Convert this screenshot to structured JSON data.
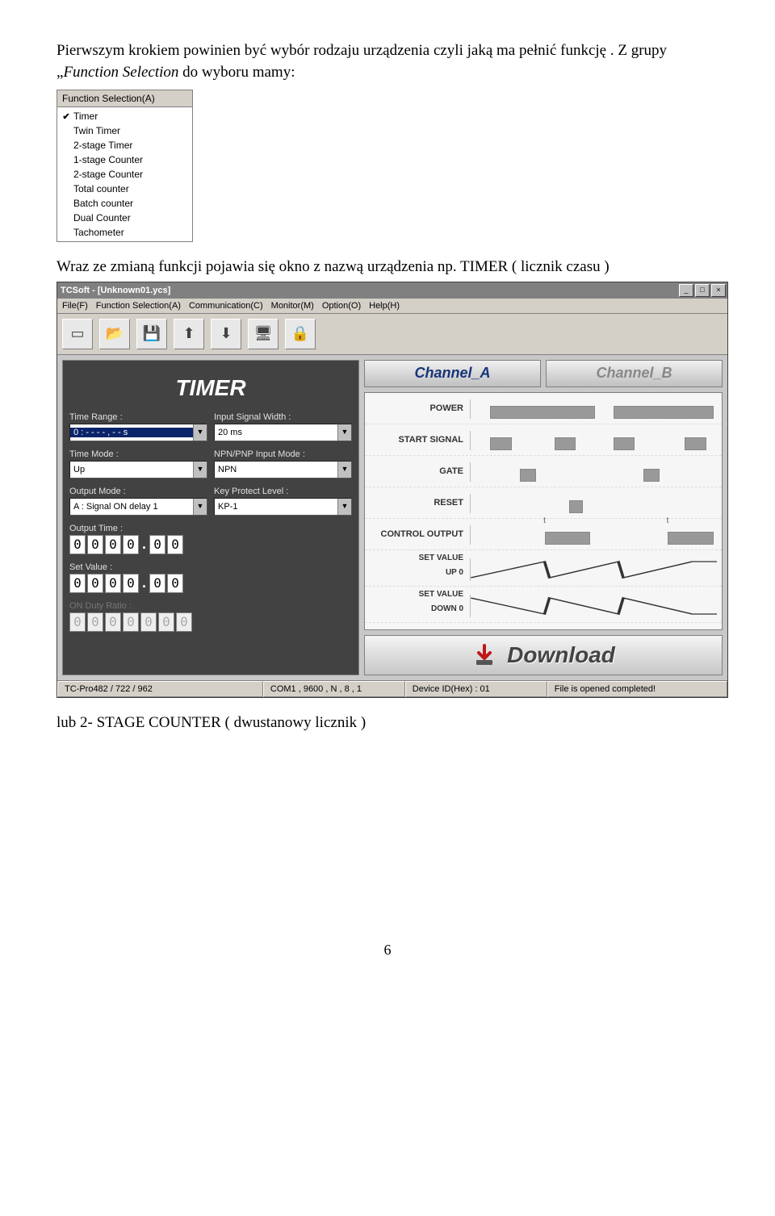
{
  "text": {
    "para1": "Pierwszym krokiem powinien być wybór rodzaju urządzenia czyli  jaką ma pełnić funkcję . Z grupy  „",
    "para1_italic": "Function Selection",
    "para1_after": " do  wyboru mamy:",
    "para2": "Wraz ze zmianą funkcji  pojawia  się okno z nazwą urządzenia np. TIMER ( licznik czasu )",
    "para3": "lub 2- STAGE COUNTER  ( dwustanowy licznik )",
    "page_number": "6"
  },
  "fs_panel": {
    "header": "Function Selection(A)",
    "items": [
      {
        "label": "Timer",
        "checked": true
      },
      {
        "label": "Twin Timer",
        "checked": false
      },
      {
        "label": "2-stage Timer",
        "checked": false
      },
      {
        "label": "1-stage Counter",
        "checked": false
      },
      {
        "label": "2-stage Counter",
        "checked": false
      },
      {
        "label": "Total counter",
        "checked": false
      },
      {
        "label": "Batch counter",
        "checked": false
      },
      {
        "label": "Dual Counter",
        "checked": false
      },
      {
        "label": "Tachometer",
        "checked": false
      }
    ]
  },
  "window": {
    "title": "TCSoft - [Unknown01.ycs]",
    "menus": [
      "File(F)",
      "Function Selection(A)",
      "Communication(C)",
      "Monitor(M)",
      "Option(O)",
      "Help(H)"
    ],
    "toolbar_icons": [
      "new",
      "open",
      "save",
      "upload",
      "download",
      "monitor",
      "lock"
    ],
    "timer_title": "TIMER",
    "channels": {
      "a": "Channel_A",
      "b": "Channel_B"
    },
    "fields_left": [
      {
        "label": "Time Range :",
        "value": "0 : - - - - , - - s",
        "selected": true
      },
      {
        "label": "Time Mode :",
        "value": "Up"
      },
      {
        "label": "Output Mode :",
        "value": "A : Signal ON delay 1"
      },
      {
        "label": "Output Time :",
        "digits": [
          "0",
          "0",
          "0",
          "0",
          ".",
          "0",
          "0"
        ]
      },
      {
        "label": "Set Value :",
        "digits": [
          "0",
          "0",
          "0",
          "0",
          ".",
          "0",
          "0"
        ]
      },
      {
        "label": "ON Duty Ratio :",
        "digits": [
          "0",
          "0",
          "0",
          "0",
          "0",
          "0",
          "0"
        ],
        "disabled": true
      }
    ],
    "fields_right": [
      {
        "label": "Input Signal Width :",
        "value": "20 ms"
      },
      {
        "label": "NPN/PNP Input Mode :",
        "value": "NPN"
      },
      {
        "label": "Key Protect Level :",
        "value": "KP-1"
      }
    ],
    "diagram_rows": [
      "POWER",
      "START  SIGNAL",
      "GATE",
      "RESET",
      "CONTROL OUTPUT"
    ],
    "diagram_setvalue_up": "SET VALUE",
    "diagram_up": "UP       0",
    "diagram_setvalue_down": "SET VALUE",
    "diagram_down": "DOWN    0",
    "diagram_t": "t",
    "download": "Download",
    "status": {
      "s1": "TC-Pro482 / 722 / 962",
      "s2": "COM1 , 9600 , N , 8 , 1",
      "s3": "Device ID(Hex) : 01",
      "s4": "File is opened completed!"
    }
  }
}
